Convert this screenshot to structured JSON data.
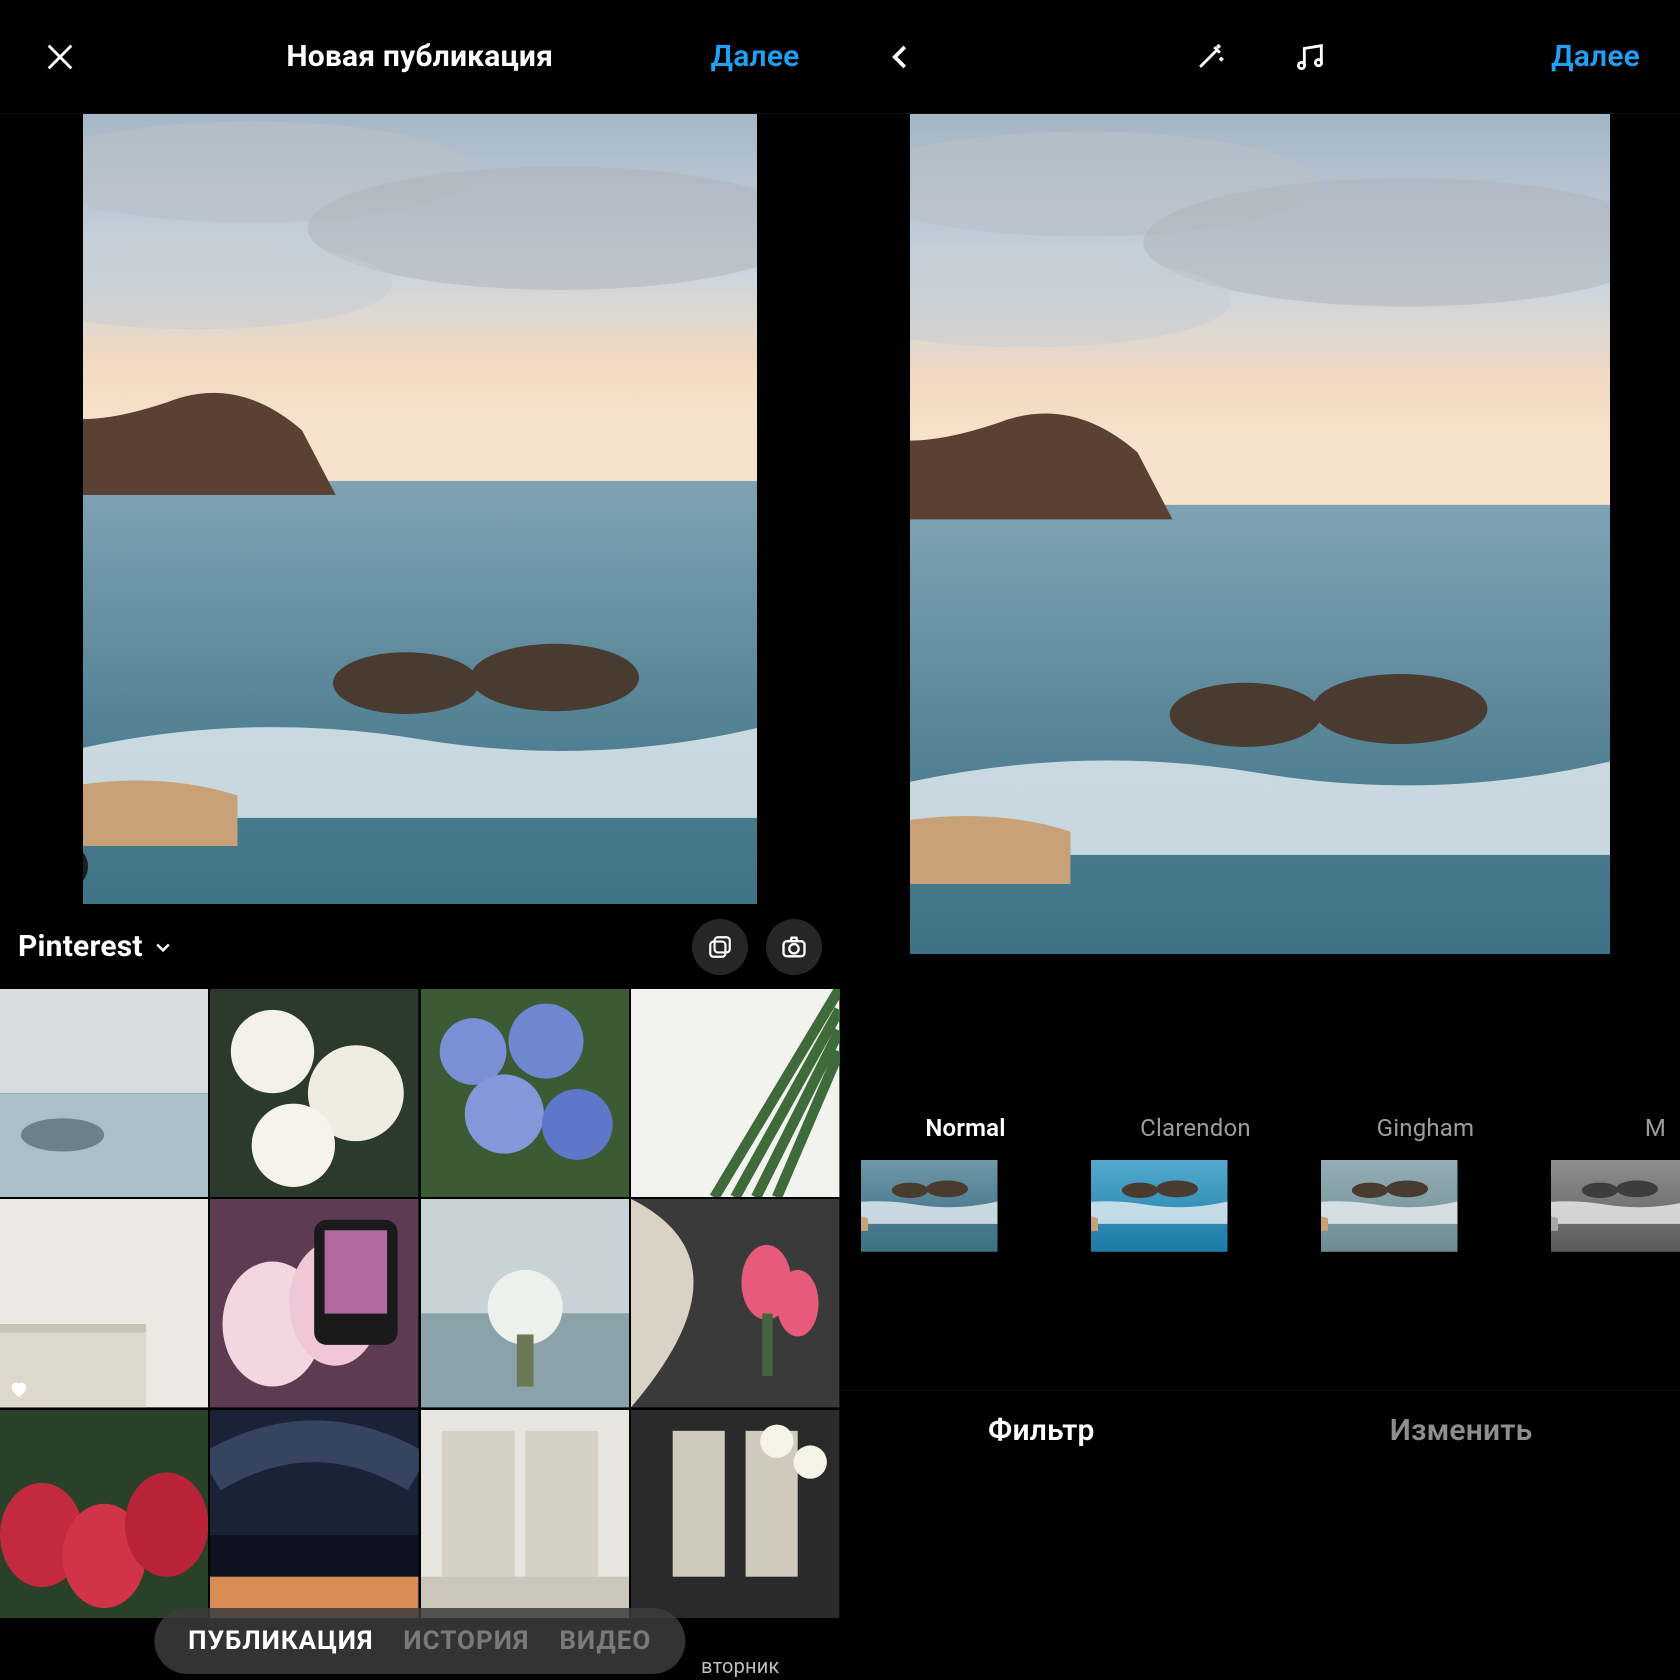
{
  "left": {
    "title": "Новая публикация",
    "next": "Далее",
    "album": "Pinterest",
    "modes": [
      "ПУБЛИКАЦИЯ",
      "ИСТОРИЯ",
      "ВИДЕО"
    ],
    "mode_last_caption": "вторник",
    "icons": {
      "close": "close-icon",
      "chevron": "chevron-down-icon",
      "multi": "multi-select-icon",
      "camera": "camera-icon",
      "expand": "expand-icon"
    }
  },
  "right": {
    "next": "Далее",
    "icons": {
      "back": "chevron-left-icon",
      "magic": "magic-wand-icon",
      "music": "music-icon"
    },
    "filters": [
      {
        "name": "Normal",
        "active": true,
        "variant": "normal"
      },
      {
        "name": "Clarendon",
        "active": false,
        "variant": "clarendon"
      },
      {
        "name": "Gingham",
        "active": false,
        "variant": "gingham"
      },
      {
        "name": "M",
        "active": false,
        "variant": "moon"
      }
    ],
    "tabs": {
      "filter": "Фильтр",
      "edit": "Изменить"
    }
  }
}
